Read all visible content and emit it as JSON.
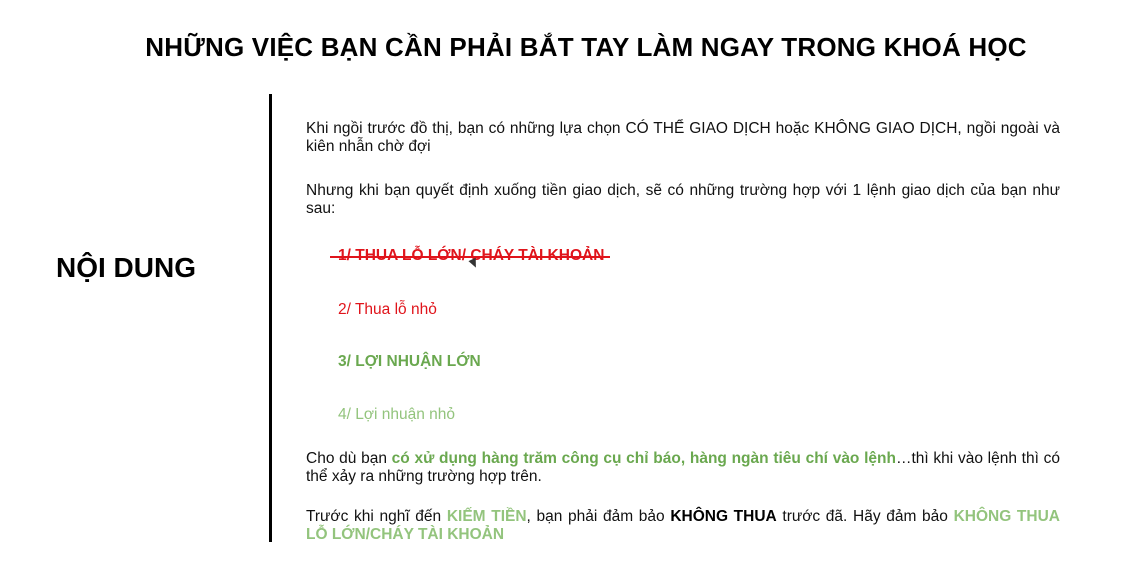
{
  "slide": {
    "title": "NHỮNG VIỆC BẠN CẦN PHẢI BẮT TAY LÀM NGAY TRONG KHOÁ HỌC",
    "section_label": "NỘI DUNG"
  },
  "content": {
    "paragraph1": "Khi ngồi trước đồ thị, bạn có những lựa chọn CÓ THỂ GIAO DỊCH hoặc KHÔNG GIAO DỊCH, ngồi ngoài và kiên nhẫn chờ đợi",
    "paragraph2": "Nhưng khi bạn quyết định xuống tiền giao dịch, sẽ có những trường hợp với 1 lệnh giao dịch của bạn như sau:",
    "cases": [
      {
        "label": "1/ THUA LỖ LỚN/ CHÁY TÀI KHOẢN",
        "color": "#e0141b",
        "style": "bold-strikethrough"
      },
      {
        "label": "2/ Thua lỗ nhỏ",
        "color": "#e0141b",
        "style": "normal"
      },
      {
        "label": "3/ LỢI NHUẬN LỚN",
        "color": "#6aa84f",
        "style": "bold"
      },
      {
        "label": "4/ Lợi nhuận nhỏ",
        "color": "#93c47d",
        "style": "normal"
      }
    ],
    "paragraph3": {
      "before": "Cho dù bạn ",
      "highlight": "có xử dụng hàng trăm công cụ chỉ báo, hàng ngàn tiêu chí vào lệnh",
      "after": "…thì khi vào lệnh thì có thể xảy ra những trường hợp trên."
    },
    "paragraph4": {
      "part1": "Trước khi nghĩ đến ",
      "highlight1": "KIẾM TIỀN",
      "part2": ", bạn phải đảm bảo ",
      "bold1": "KHÔNG THUA",
      "part3": " trước đã. Hãy đảm bảo ",
      "highlight2": "KHÔNG THUA LỖ LỚN/CHÁY TÀI KHOẢN"
    }
  },
  "colors": {
    "red": "#e0141b",
    "green": "#6aa84f",
    "light_green": "#93c47d",
    "divider": "#000000"
  },
  "icons": {
    "cursor": "mouse-pointer-icon"
  }
}
